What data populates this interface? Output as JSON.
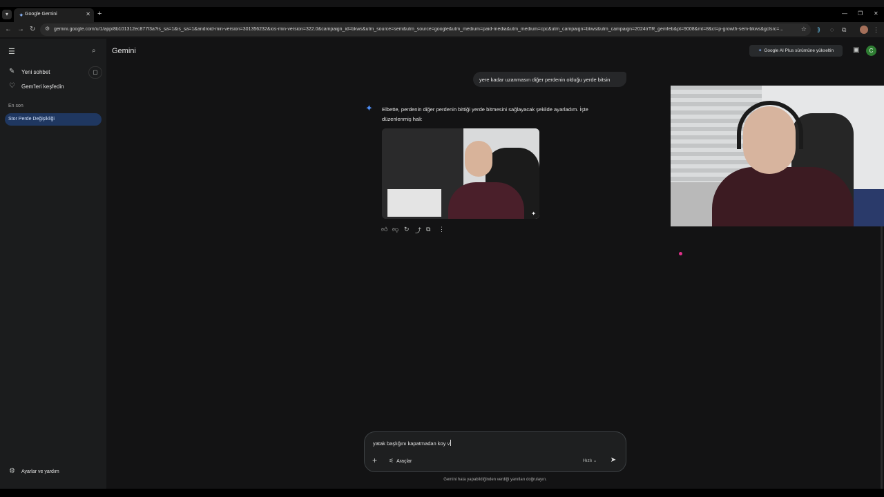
{
  "browser": {
    "tab_title": "Google Gemini",
    "url": "gemini.google.com/u/1/app/8b101312ec877f3a?is_sa=1&is_sa=1&android-min-version=301356232&ios-min-version=322.0&campaign_id=bkws&utm_source=sem&utm_source=google&utm_medium=paid-media&utm_medium=cpc&utm_campaign=bkws&utm_campaign=2024trTR_gemfeb&pt=9008&mt=8&ct=p-growth-sem-bkws&gclsrc=..."
  },
  "sidebar": {
    "new_chat": "Yeni sohbet",
    "explore_gems": "Gem'leri keşfedin",
    "recent_label": "En son",
    "recent_items": [
      "Stor Perde Değişikliği"
    ],
    "settings": "Ayarlar ve yardım"
  },
  "header": {
    "brand": "Gemini",
    "upgrade_label": "Google AI Plus sürümüne yükseltin",
    "avatar_letter": "C"
  },
  "chat": {
    "user_message": "yere kadar uzanmasın diğer perdenin olduğu yerde bitsin",
    "response_text": "Elbette, perdenin diğer perdenin bittiği yerde bitmesini sağlayacak şekilde ayarladım. İşte düzenlenmiş hali:"
  },
  "composer": {
    "typed_text": "yatak başlığını kapatmadan koy v",
    "tools_label": "Araçlar",
    "mode_label": "Hızlı",
    "disclaimer": "Gemini hata yapabildiğinden verdiği yanıtları doğrulayın."
  },
  "colors": {
    "accent": "#4c8df6",
    "background": "#131314",
    "sidebar": "#1b1c1d",
    "recent_selected": "#1f3760",
    "avatar": "#2e7d32"
  }
}
